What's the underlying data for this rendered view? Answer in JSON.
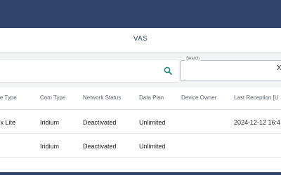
{
  "header": {
    "tab_label": "VAS"
  },
  "search": {
    "label": "Search",
    "value": "",
    "clear_glyph": "X"
  },
  "table": {
    "columns": [
      "vice Type",
      "Com Type",
      "Network Status",
      "Data Plan",
      "Device Owner",
      "Last Reception [U"
    ],
    "rows": [
      {
        "device_type": "rtex Lite",
        "com_type": "Iridium",
        "network_status": "Deactivated",
        "data_plan": "Unlimited",
        "device_owner": "",
        "last_reception": "2024-12-12 16:4"
      },
      {
        "device_type": "",
        "com_type": "Iridium",
        "network_status": "Deactivated",
        "data_plan": "Unlimited",
        "device_owner": "",
        "last_reception": ""
      }
    ]
  },
  "colors": {
    "header_bg": "#2e4468",
    "search_icon": "#1f8a7a"
  },
  "icons": {
    "search": "search-icon",
    "clear": "close-icon"
  }
}
